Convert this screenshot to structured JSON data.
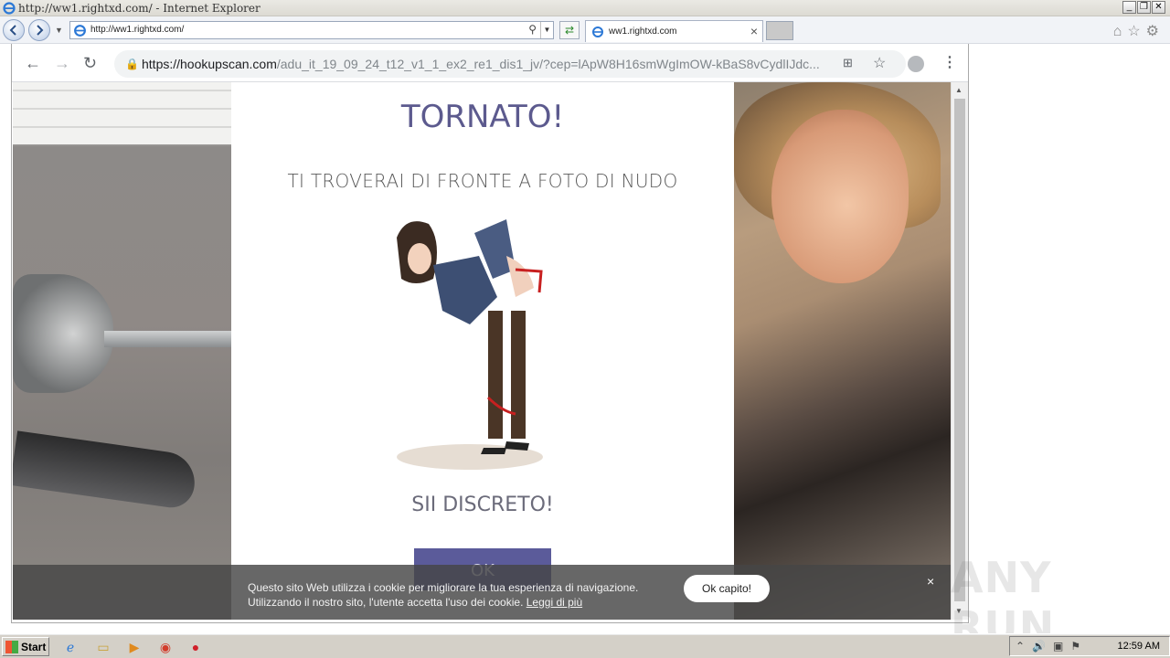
{
  "ie": {
    "window_title": "http://ww1.rightxd.com/ - Internet Explorer",
    "address": "http://ww1.rightxd.com/",
    "tab_label": "ww1.rightxd.com",
    "minimize": "_",
    "restore": "❐",
    "close": "✕"
  },
  "chrome": {
    "url_domain": "https://hookupscan.com",
    "url_path": "/adu_it_19_09_24_t12_v1_1_ex2_re1_dis1_jv/?cep=lApW8H16smWgImOW-kBaS8vCydlIJdc..."
  },
  "page": {
    "headline": "TORNATO!",
    "subhead": "TI TROVERAI DI FRONTE A FOTO DI NUDO",
    "discreet": "SII DISCRETO!",
    "ok_button": "OK"
  },
  "cookie": {
    "line1": "Questo sito Web utilizza i cookie per migliorare la tua esperienza di navigazione.",
    "line2": "Utilizzando il nostro sito, l'utente accetta l'uso dei cookie.",
    "link": "Leggi di più",
    "accept": "Ok capito!",
    "close": "×"
  },
  "watermark": "ANY RUN",
  "taskbar": {
    "start": "Start",
    "clock": "12:59 AM"
  },
  "colors": {
    "headline": "#5c5a8e",
    "ok_button": "#5b5b9a"
  }
}
